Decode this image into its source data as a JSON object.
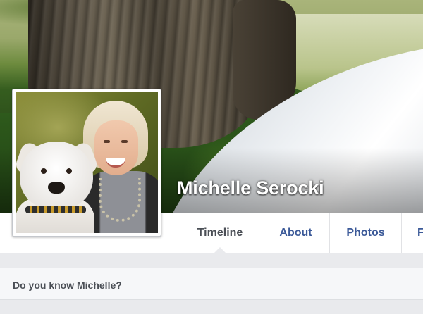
{
  "profile": {
    "name": "Michelle Serocki"
  },
  "nav": {
    "tabs": [
      {
        "label": "Timeline",
        "active": true
      },
      {
        "label": "About",
        "active": false
      },
      {
        "label": "Photos",
        "active": false
      },
      {
        "label": "F",
        "active": false
      }
    ]
  },
  "know_card": {
    "text": "Do you know Michelle?"
  },
  "colors": {
    "link": "#3b5998",
    "active_tab": "#4b4f56",
    "page_bg": "#e9eaed"
  }
}
